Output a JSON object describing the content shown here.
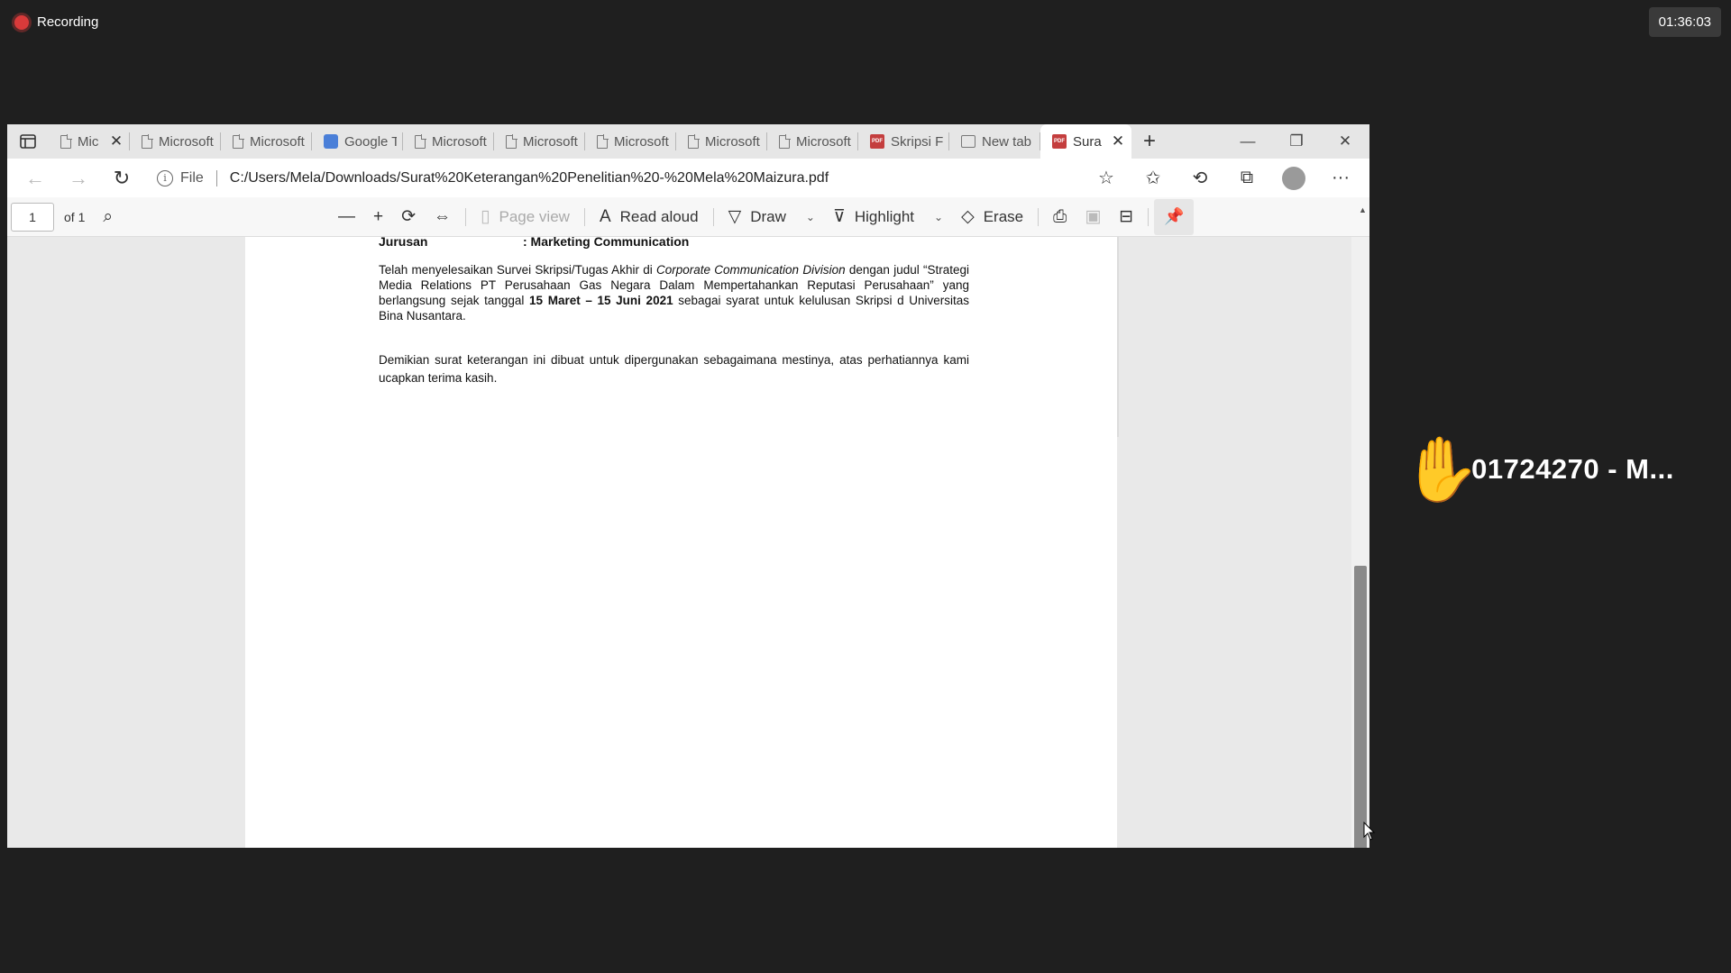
{
  "recording": {
    "label": "Recording"
  },
  "timer": {
    "value": "01:36:03"
  },
  "browser": {
    "tabs": [
      {
        "label": "Mic",
        "icon": "document-icon",
        "close": "✕"
      },
      {
        "label": "Microsoft",
        "icon": "document-icon"
      },
      {
        "label": "Microsoft",
        "icon": "document-icon"
      },
      {
        "label": "Google T",
        "icon": "google-translate-icon"
      },
      {
        "label": "Microsoft",
        "icon": "document-icon"
      },
      {
        "label": "Microsoft",
        "icon": "document-icon"
      },
      {
        "label": "Microsoft",
        "icon": "document-icon"
      },
      {
        "label": "Microsoft",
        "icon": "document-icon"
      },
      {
        "label": "Microsoft",
        "icon": "document-icon"
      },
      {
        "label": "Skripsi Fi",
        "icon": "pdf-icon"
      },
      {
        "label": "New tab",
        "icon": "new-tab-icon"
      },
      {
        "label": "Sura",
        "icon": "pdf-icon",
        "active": true,
        "close": "✕"
      }
    ],
    "new_tab": "+",
    "address": {
      "scheme_label": "File",
      "url": "C:/Users/Mela/Downloads/Surat%20Keterangan%20Penelitian%20-%20Mela%20Maizura.pdf"
    },
    "window_controls": {
      "minimize": "—",
      "restore": "❐",
      "close": "✕"
    }
  },
  "pdf_toolbar": {
    "page_number": "1",
    "page_total": "of 1",
    "page_view": "Page view",
    "read_aloud": "Read aloud",
    "draw": "Draw",
    "highlight": "Highlight",
    "erase": "Erase"
  },
  "document": {
    "jurusan_label": "Jurusan",
    "jurusan_value": ": Marketing Communication",
    "para1_a": "Telah menyelesaikan Survei Skripsi/Tugas Akhir di ",
    "para1_italic": "Corporate Communication Division",
    "para1_b": " dengan judul “Strategi Media Relations PT Perusahaan Gas Negara Dalam Mempertahankan Reputasi Perusahaan” yang berlangsung sejak tanggal ",
    "para1_bold": "15 Maret – 15 Juni 2021",
    "para1_c": " sebagai syarat untuk kelulusan Skripsi d Universitas Bina Nusantara.",
    "para2": "Demikian surat keterangan ini dibuat untuk dipergunakan sebagaimana mestinya, atas perhatiannya kami ucapkan terima kasih."
  },
  "participant": {
    "name": "01724270 - M...",
    "icon": "raised-hand-icon"
  }
}
